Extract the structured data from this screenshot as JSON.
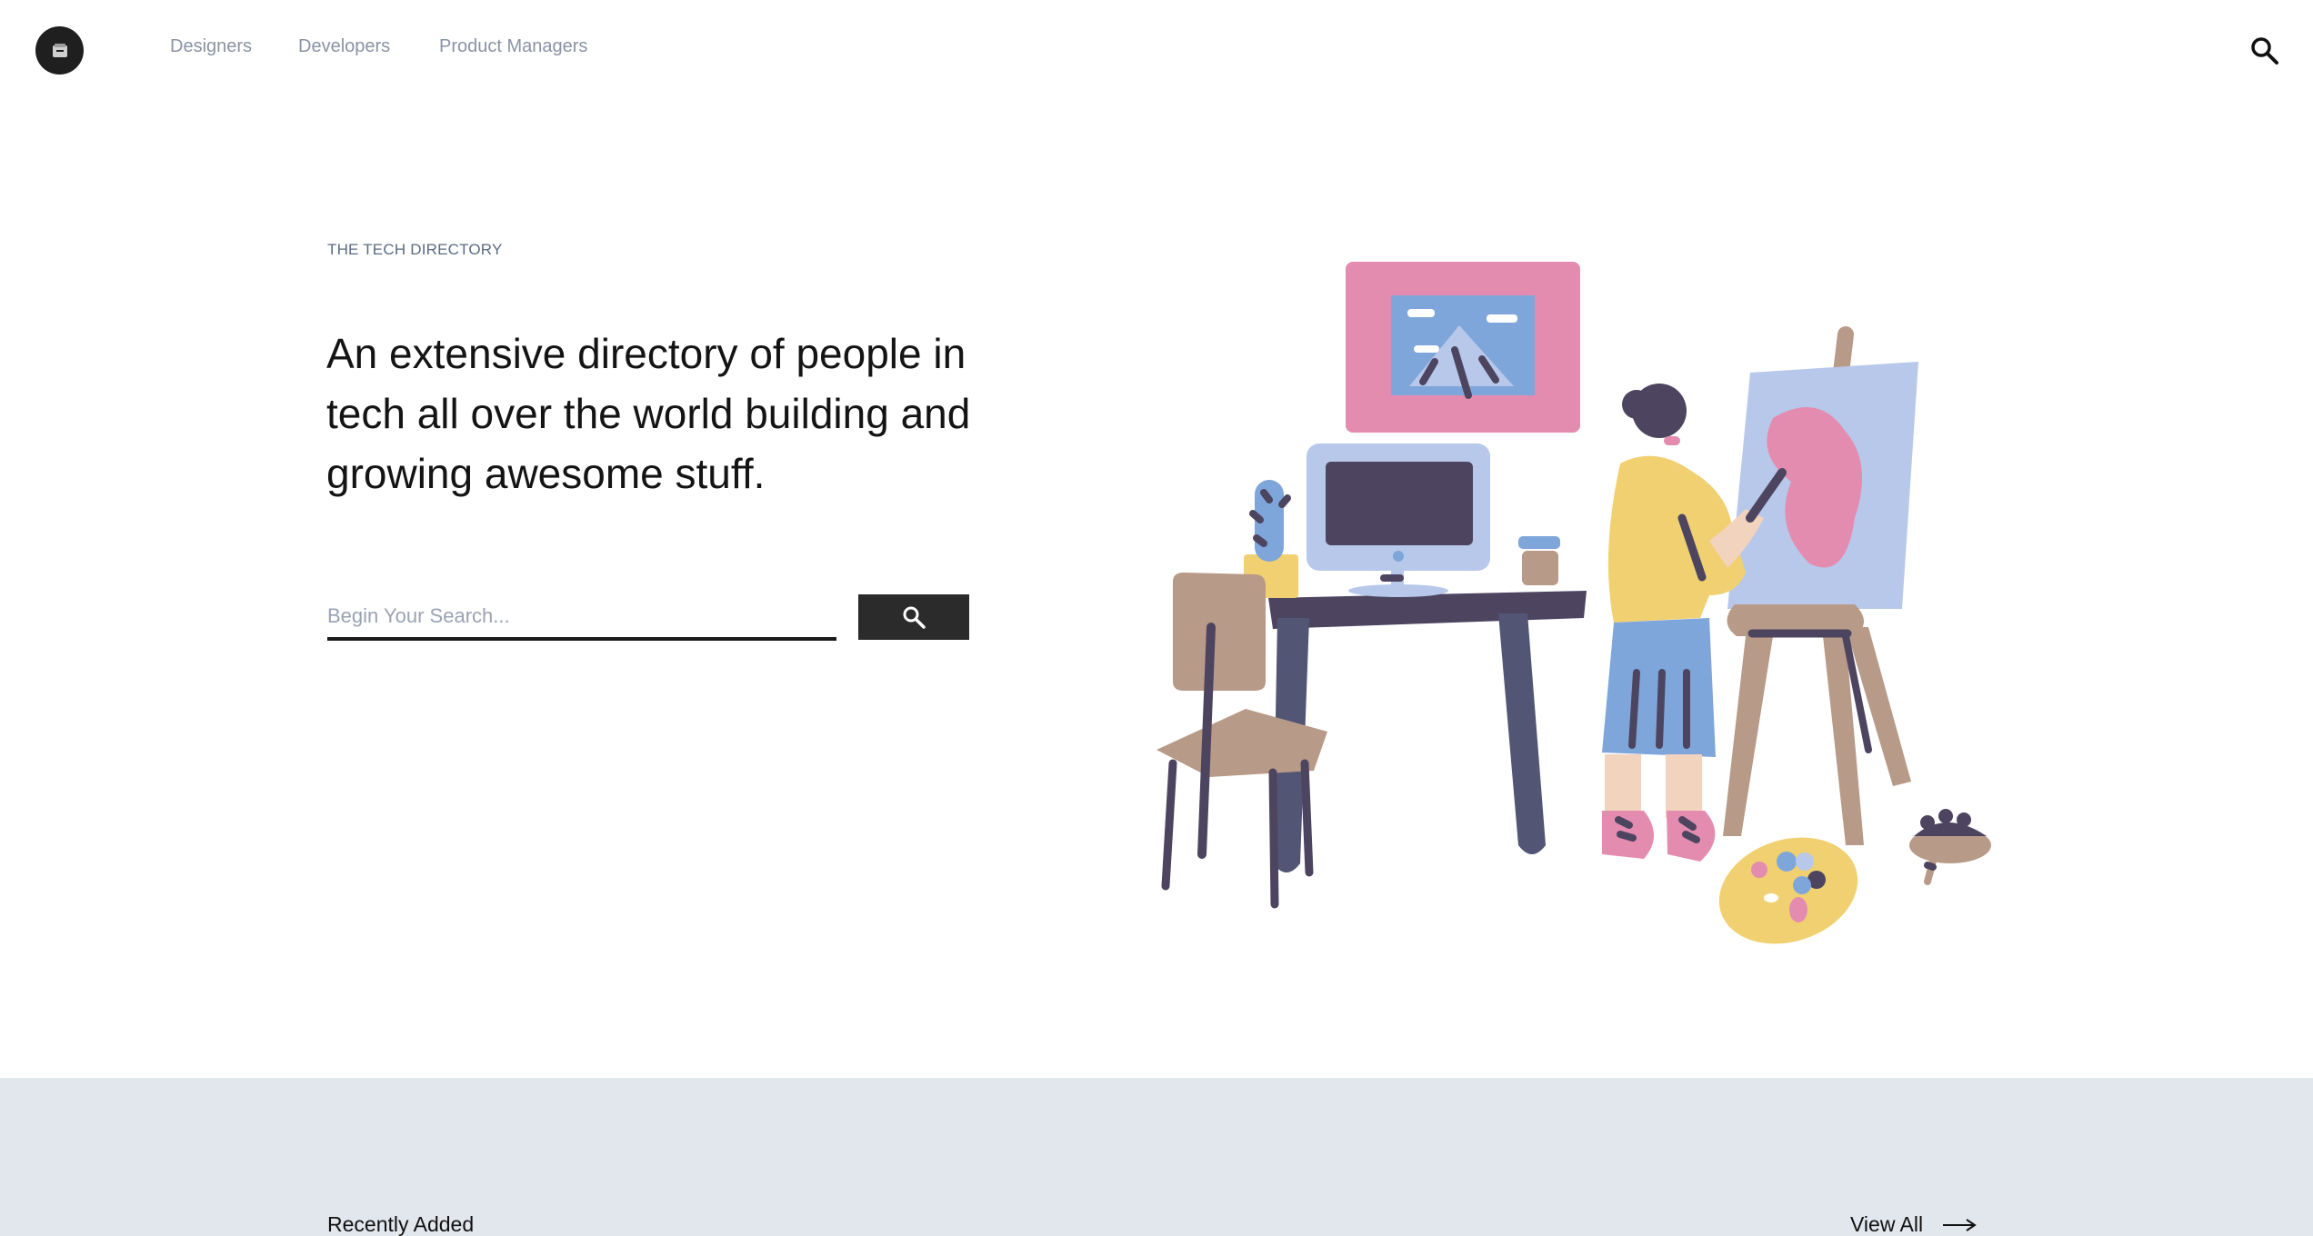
{
  "nav": {
    "links": [
      {
        "label": "Designers"
      },
      {
        "label": "Developers"
      },
      {
        "label": "Product Managers"
      }
    ]
  },
  "hero": {
    "eyebrow": "THE TECH DIRECTORY",
    "headline": "An extensive directory of people in tech all over the world building and growing awesome stuff.",
    "search_placeholder": "Begin Your Search..."
  },
  "recent": {
    "title": "Recently Added",
    "view_all_label": "View All"
  },
  "icons": {
    "logo": "box-logo-icon",
    "nav_search": "search-icon",
    "button_search": "search-icon",
    "view_all_arrow": "arrow-right-icon"
  },
  "colors": {
    "nav_link": "#8a93a3",
    "eyebrow": "#5b6b82",
    "button_bg": "#2b2b2b",
    "section_bg": "#e2e7ee",
    "pink": "#e48cb0",
    "blue": "#7ea6da",
    "yellow": "#f1d071",
    "purple": "#4d4560",
    "tan": "#b89a88"
  }
}
